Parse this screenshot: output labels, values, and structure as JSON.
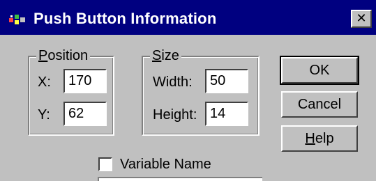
{
  "window": {
    "title": "Push Button Information",
    "close_glyph": "✕",
    "colors": {
      "titlebar": "#000080",
      "title_text": "#ffffff",
      "face": "#c0c0c0"
    }
  },
  "position": {
    "legend_accel": "P",
    "legend_rest": "osition",
    "x_label": "X:",
    "x_value": "170",
    "y_label": "Y:",
    "y_value": "62"
  },
  "size": {
    "legend_accel": "S",
    "legend_rest": "ize",
    "width_label": "Width:",
    "width_value": "50",
    "height_label": "Height:",
    "height_value": "14"
  },
  "buttons": {
    "ok": "OK",
    "cancel": "Cancel",
    "help_accel": "H",
    "help_rest": "elp"
  },
  "variable_name": {
    "label": "Variable Name",
    "checked": false
  },
  "icons": {
    "app": "app-icon",
    "close": "close-icon",
    "checkbox": "checkbox-icon"
  }
}
